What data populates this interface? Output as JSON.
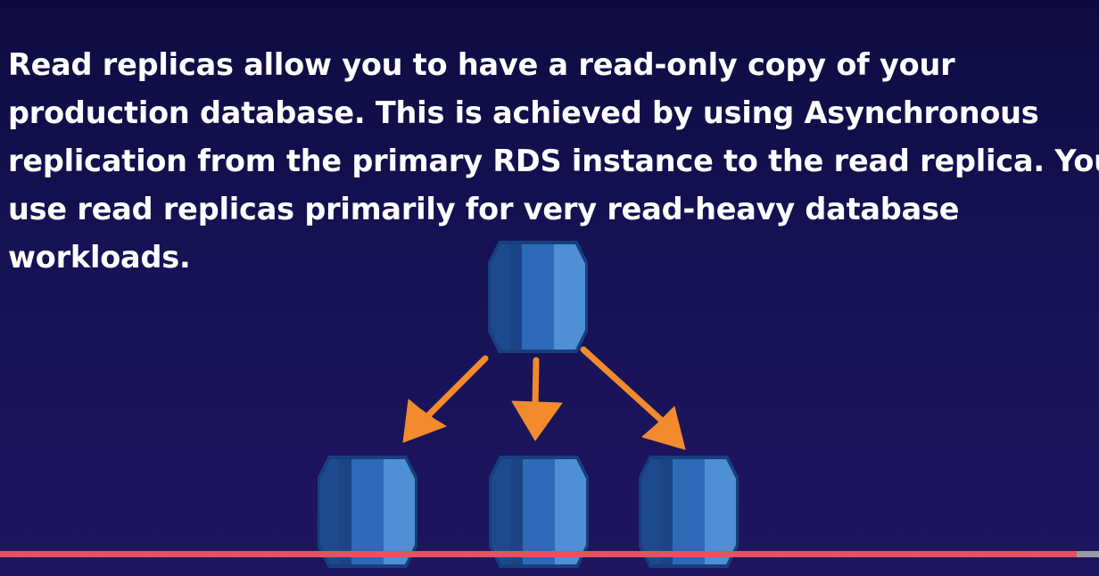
{
  "slide": {
    "lines": [
      "Read replicas allow you to have a read-only copy of your",
      "production database. This is achieved by using Asynchronous",
      "replication from the primary RDS instance to the read replica. You",
      "use read replicas primarily for very read-heavy database",
      "workloads."
    ]
  },
  "diagram": {
    "icon": "database-icon",
    "arrow_icon": "arrow-down-icon",
    "colors": {
      "db_dark": "#1d4a8f",
      "db_mid": "#2e6ab8",
      "db_light": "#4f8fd4",
      "db_edge": "#173f7d",
      "arrow": "#f28a2e"
    }
  },
  "video": {
    "progress": 0.98,
    "progress_color": "#e8515d"
  }
}
